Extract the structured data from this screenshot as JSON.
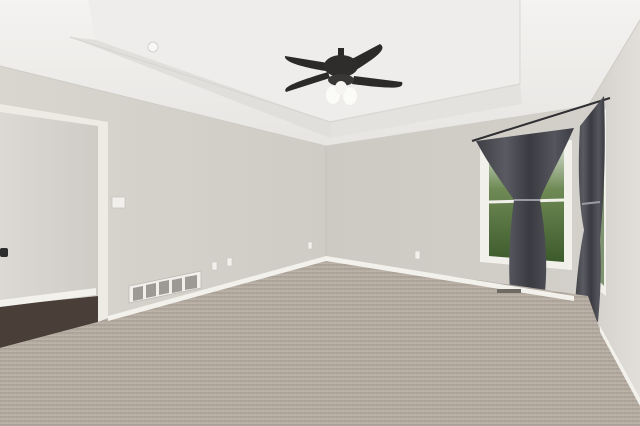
{
  "scene": {
    "kind": "photograph",
    "subject": "empty-bedroom",
    "text_in_image": []
  },
  "palette": {
    "ceiling": "#f1f0ee",
    "tray_ceiling": "#e8e7e4",
    "back_wall": "#d3cfc9",
    "left_wall": "#d5d1cb",
    "right_wall": "#dcd9d4",
    "carpet": "#b3a99f",
    "baseboard": "#f3f1ec",
    "trim": "#efece6",
    "curtain": "#4b4c52",
    "fan_blade": "#2c2a29",
    "window_green": "#4e6b3a",
    "hall_floor": "#4a3f38"
  },
  "objects": [
    "ceiling-fan",
    "tray-ceiling",
    "left-doorway",
    "window",
    "curtains",
    "floor-vent",
    "light-switch",
    "outlets",
    "carpet"
  ]
}
